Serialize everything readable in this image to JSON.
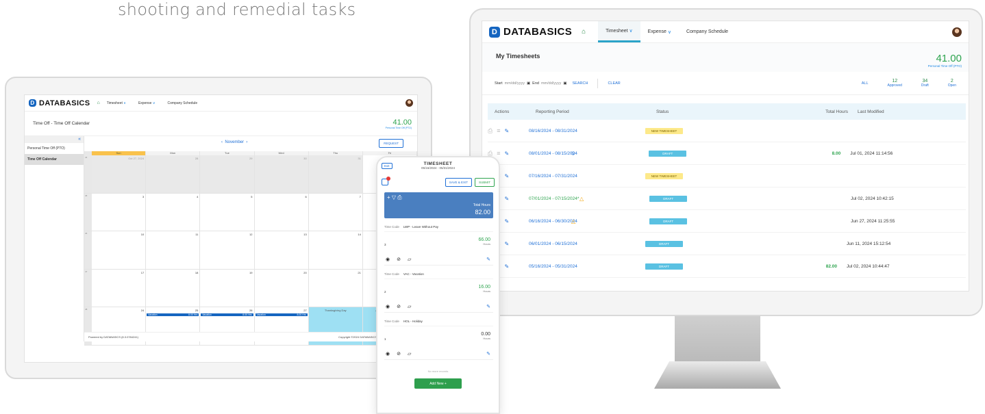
{
  "heading": "shooting and remedial tasks",
  "brand": {
    "name": "DATABASICS",
    "mark": "D"
  },
  "nav": {
    "timesheet": "Timesheet",
    "expense": "Expense",
    "company_schedule": "Company Schedule"
  },
  "monitor": {
    "page_title": "My Timesheets",
    "pto": {
      "value": "41.00",
      "label": "Personal Time Off (PTO)"
    },
    "filter": {
      "start_label": "Start",
      "start_placeholder": "mm/dd/yyyy",
      "end_label": "End",
      "end_placeholder": "mm/dd/yyyy",
      "search": "SEARCH",
      "clear": "CLEAR"
    },
    "counts": {
      "all": "ALL",
      "approved": {
        "n": "12",
        "label": "Approved"
      },
      "draft": {
        "n": "34",
        "label": "Draft"
      },
      "open": {
        "n": "2",
        "label": "Open"
      }
    },
    "columns": {
      "actions": "Actions",
      "period": "Reporting Period",
      "status": "Status",
      "hours": "Total Hours",
      "modified": "Last Modified"
    },
    "rows": [
      {
        "period": "08/16/2024 - 08/31/2024",
        "status": "NEW TIMESHEET",
        "hours": "",
        "modified": ""
      },
      {
        "period": "08/01/2024 - 08/15/2024",
        "status": "DRAFT",
        "hours": "8.00",
        "modified": "Jul 01, 2024 11:14:56"
      },
      {
        "period": "07/16/2024 - 07/31/2024",
        "status": "NEW TIMESHEET",
        "hours": "",
        "modified": ""
      },
      {
        "period": "07/01/2024 - 07/15/2024*",
        "status": "DRAFT",
        "hours": "",
        "modified": "Jul 02, 2024 10:42:15"
      },
      {
        "period": "06/16/2024 - 06/30/2024",
        "status": "DRAFT",
        "hours": "",
        "modified": "Jun 27, 2024 11:25:55"
      },
      {
        "period": "06/01/2024 - 06/15/2024",
        "status": "DRAFT",
        "hours": "",
        "modified": "Jun 11, 2024 15:12:54"
      },
      {
        "period": "05/16/2024 - 05/31/2024",
        "status": "DRAFT",
        "hours": "82.00",
        "modified": "Jul 02, 2024 10:44:47"
      }
    ]
  },
  "tablet": {
    "page_title": "Time Off - Time Off Calendar",
    "pto": {
      "value": "41.00",
      "label": "Personal Time Off (PTO)"
    },
    "sidebar": {
      "collapse": "«",
      "items": [
        "Personal Time Off (PTO)",
        "Time Off Calendar"
      ]
    },
    "month": "November",
    "request": "REQUEST",
    "days": [
      "Sun",
      "Mon",
      "Tue",
      "Wed",
      "Thu",
      "Fri"
    ],
    "weeks": [
      {
        "wk": "44",
        "cells": [
          "Oct 27, 2024",
          "28",
          "29",
          "30",
          "31",
          "Nov 1"
        ]
      },
      {
        "wk": "45",
        "cells": [
          "3",
          "4",
          "5",
          "6",
          "7",
          "8"
        ]
      },
      {
        "wk": "46",
        "cells": [
          "10",
          "11",
          "12",
          "13",
          "14",
          "15"
        ]
      },
      {
        "wk": "47",
        "cells": [
          "17",
          "18",
          "19",
          "20",
          "21",
          "22"
        ]
      },
      {
        "wk": "48",
        "cells": [
          "24",
          "25",
          "26",
          "27",
          "Thanksgiving Day",
          "After Thanksgiving Day"
        ]
      }
    ],
    "vacation": {
      "label": "Vacation",
      "hours": "8.00 Hrs"
    },
    "footer_left": "Powered by DATABASICS (8.3.0784241)",
    "footer_right": "Copyright ©2024 DATABASICS, Inc. All rights reserved. Priva"
  },
  "phone": {
    "exit": "Exit",
    "title": "TIMESHEET",
    "range": "05/16/2024 - 05/31/2024",
    "save_exit": "SAVE & EXIT",
    "submit": "SUBMIT",
    "total_label": "Total Hours",
    "total_value": "82.00",
    "cards": [
      {
        "code_label": "Time Code",
        "code": "LWP - Leave Without Pay",
        "num": "3",
        "hours": "66.00",
        "unit": "Hours"
      },
      {
        "code_label": "Time Code",
        "code": "VAC - Vacation",
        "num": "2",
        "hours": "16.00",
        "unit": "Hours"
      },
      {
        "code_label": "Time Code",
        "code": "HOL - Holiday",
        "num": "1",
        "hours": "0.00",
        "unit": "Hours"
      }
    ],
    "no_more": "No more records",
    "add_new": "Add New +"
  }
}
